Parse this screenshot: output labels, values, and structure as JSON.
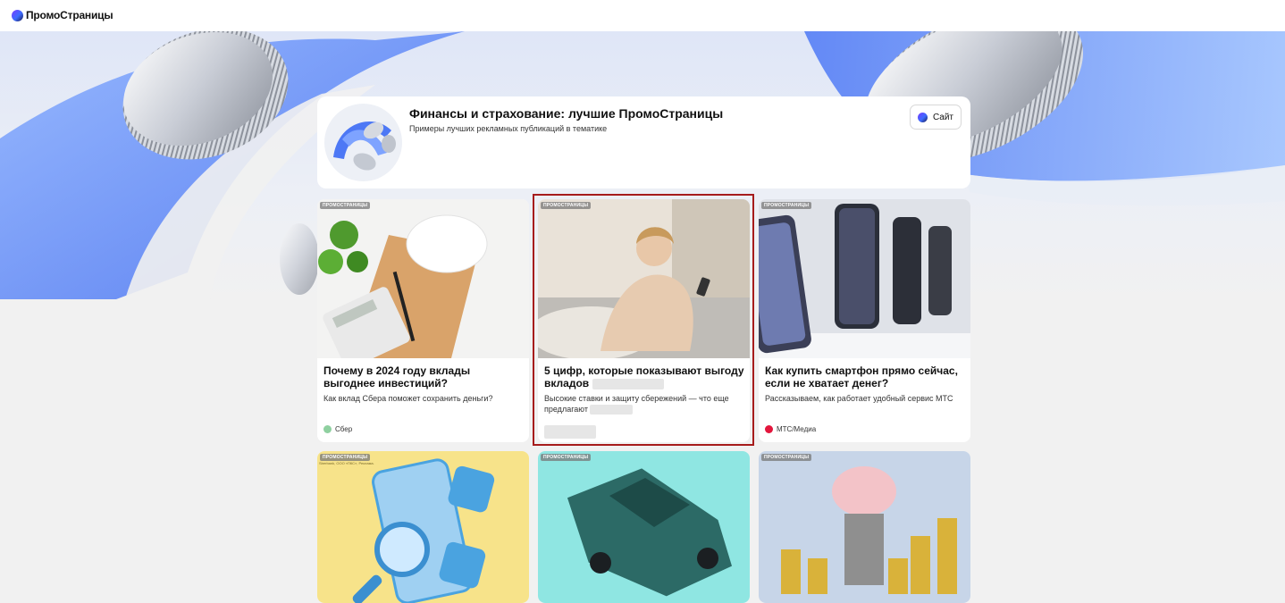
{
  "brand": {
    "name": "ПромоСтраницы"
  },
  "header": {
    "title": "Финансы и страхование: лучшие ПромоСтраницы",
    "subtitle": "Примеры лучших рекламных публикаций в тематике",
    "site_button": "Сайт"
  },
  "badge_label": "ПРОМОСТРАНИЦЫ",
  "cards": [
    {
      "title": "Почему в 2024 году вклады выгоднее инвестиций?",
      "desc": "Как вклад Сбера поможет сохранить деньги?",
      "source": "Сбер",
      "source_color": "#8fd0a0"
    },
    {
      "title": "5 цифр, которые показывают выгоду вкладов",
      "desc": "Высокие ставки и защиту сбережений — что еще предлагают",
      "source": "",
      "source_color": ""
    },
    {
      "title": "Как купить смартфон прямо сейчас, если не хватает денег?",
      "desc": "Рассказываем, как работает удобный сервис МТС",
      "source": "МТС/Медиа",
      "source_color": "#e3163c"
    }
  ],
  "lower_cards": [
    {
      "fineprint": "Sberbank, ООО «ПКС», Реклама."
    },
    {
      "fineprint": ""
    },
    {
      "fineprint": ""
    }
  ],
  "colors": {
    "accent_blue": "#3c6bff",
    "highlight": "#a61c1c",
    "background": "#f1f1f1"
  }
}
